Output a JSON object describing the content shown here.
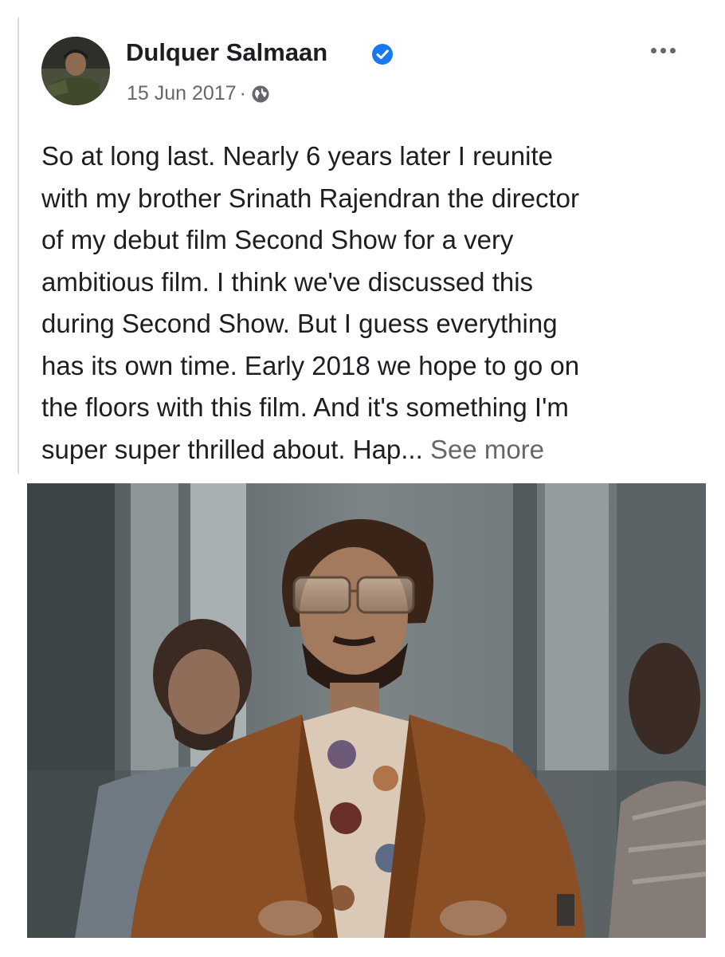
{
  "post": {
    "author": "Dulquer Salmaan",
    "date": "15 Jun 2017",
    "meta_separator": "·",
    "privacy_icon": "globe-icon",
    "verified_icon": "verified-badge-icon",
    "more_icon": "more-options-icon",
    "text": "So at long last. Nearly 6 years later I reunite\nwith my brother Srinath Rajendran the director\nof my debut film Second Show for a very\nambitious film. I think we've discussed this\nduring Second Show. But I guess everything\nhas its own time. Early 2018 we hope to go on\nthe floors with this film. And it's something I'm\nsuper super thrilled about. Hap... ",
    "see_more": "See more"
  },
  "colors": {
    "text_primary": "#1c1e21",
    "text_secondary": "#65676b",
    "verified_blue": "#1877f2",
    "jacket_brown": "#8a4f24"
  }
}
